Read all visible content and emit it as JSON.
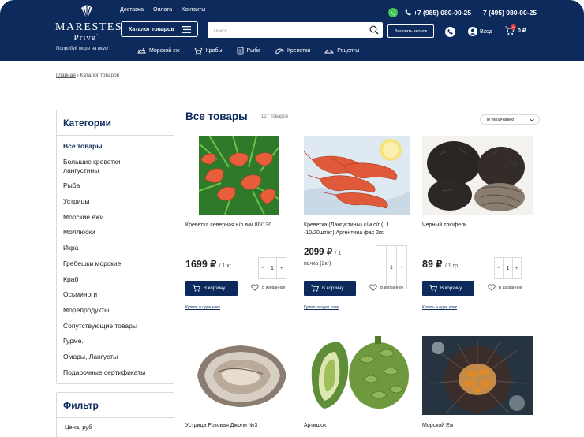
{
  "header": {
    "logo": {
      "title": "MARESTES",
      "subtitle": "Prive`"
    },
    "tagline": "Попробуй море на вкус!",
    "top_links": [
      "Доставка",
      "Оплата",
      "Контакты"
    ],
    "catalog_button": "Каталог товаров",
    "search_placeholder": "Поиск",
    "callback_button": "Заказать звонок",
    "phones": [
      "+7 (985) 080-00-25",
      "+7 (495) 080-00-25"
    ],
    "login_label": "Вход",
    "cart": {
      "total": "0 ₽",
      "count": "0"
    },
    "categories_nav": [
      {
        "label": "Морской еж",
        "icon": "urchin-icon"
      },
      {
        "label": "Крабы",
        "icon": "crab-icon"
      },
      {
        "label": "Рыба",
        "icon": "fish-icon"
      },
      {
        "label": "Креветки",
        "icon": "shrimp-icon"
      },
      {
        "label": "Рецепты",
        "icon": "dish-icon"
      }
    ]
  },
  "breadcrumb": {
    "home": "Главная",
    "separator": "›",
    "current": "Каталог товаров"
  },
  "sidebar": {
    "title": "Категории",
    "items": [
      "Все товары",
      "Большие креветки лангустины",
      "Рыба",
      "Устрицы",
      "Морские ежи",
      "Моллюски",
      "Икра",
      "Гребешки морские",
      "Краб",
      "Осьминоги",
      "Морепродукты",
      "Сопутствующие товары",
      "Гурме.",
      "Омары, Лангусты",
      "Подарочные сертификаты"
    ]
  },
  "filter": {
    "title": "Фильтр",
    "price_label": "Цена, руб"
  },
  "main": {
    "title": "Все товары",
    "count": "127 товаров",
    "sort": "По умолчанию"
  },
  "labels": {
    "to_cart": "В корзину",
    "to_favorites": "В избранное",
    "one_click": "Купить в один клик"
  },
  "products": [
    {
      "name": "Креветка северная н/р в/м 80/130",
      "price": "1699 ₽",
      "unit": "/ 1 кг",
      "qty": "1"
    },
    {
      "name": "Креветка (Лангустины) с/м с/г (L1 -10/20шт/кг) Аргентина фас 2кг.",
      "price": "2099 ₽",
      "unit": "/ 1",
      "pack": "пачка (2кг)",
      "qty": "1"
    },
    {
      "name": "Черный трюфель",
      "price": "89 ₽",
      "unit": "/ 1 гр",
      "qty": "1"
    },
    {
      "name": "Устрица Розовая Джоли №3"
    },
    {
      "name": "Артишок"
    },
    {
      "name": "Морской Еж"
    }
  ],
  "colors": {
    "navy": "#0d2a5c",
    "whatsapp": "#43c553",
    "badge": "#e53935"
  }
}
